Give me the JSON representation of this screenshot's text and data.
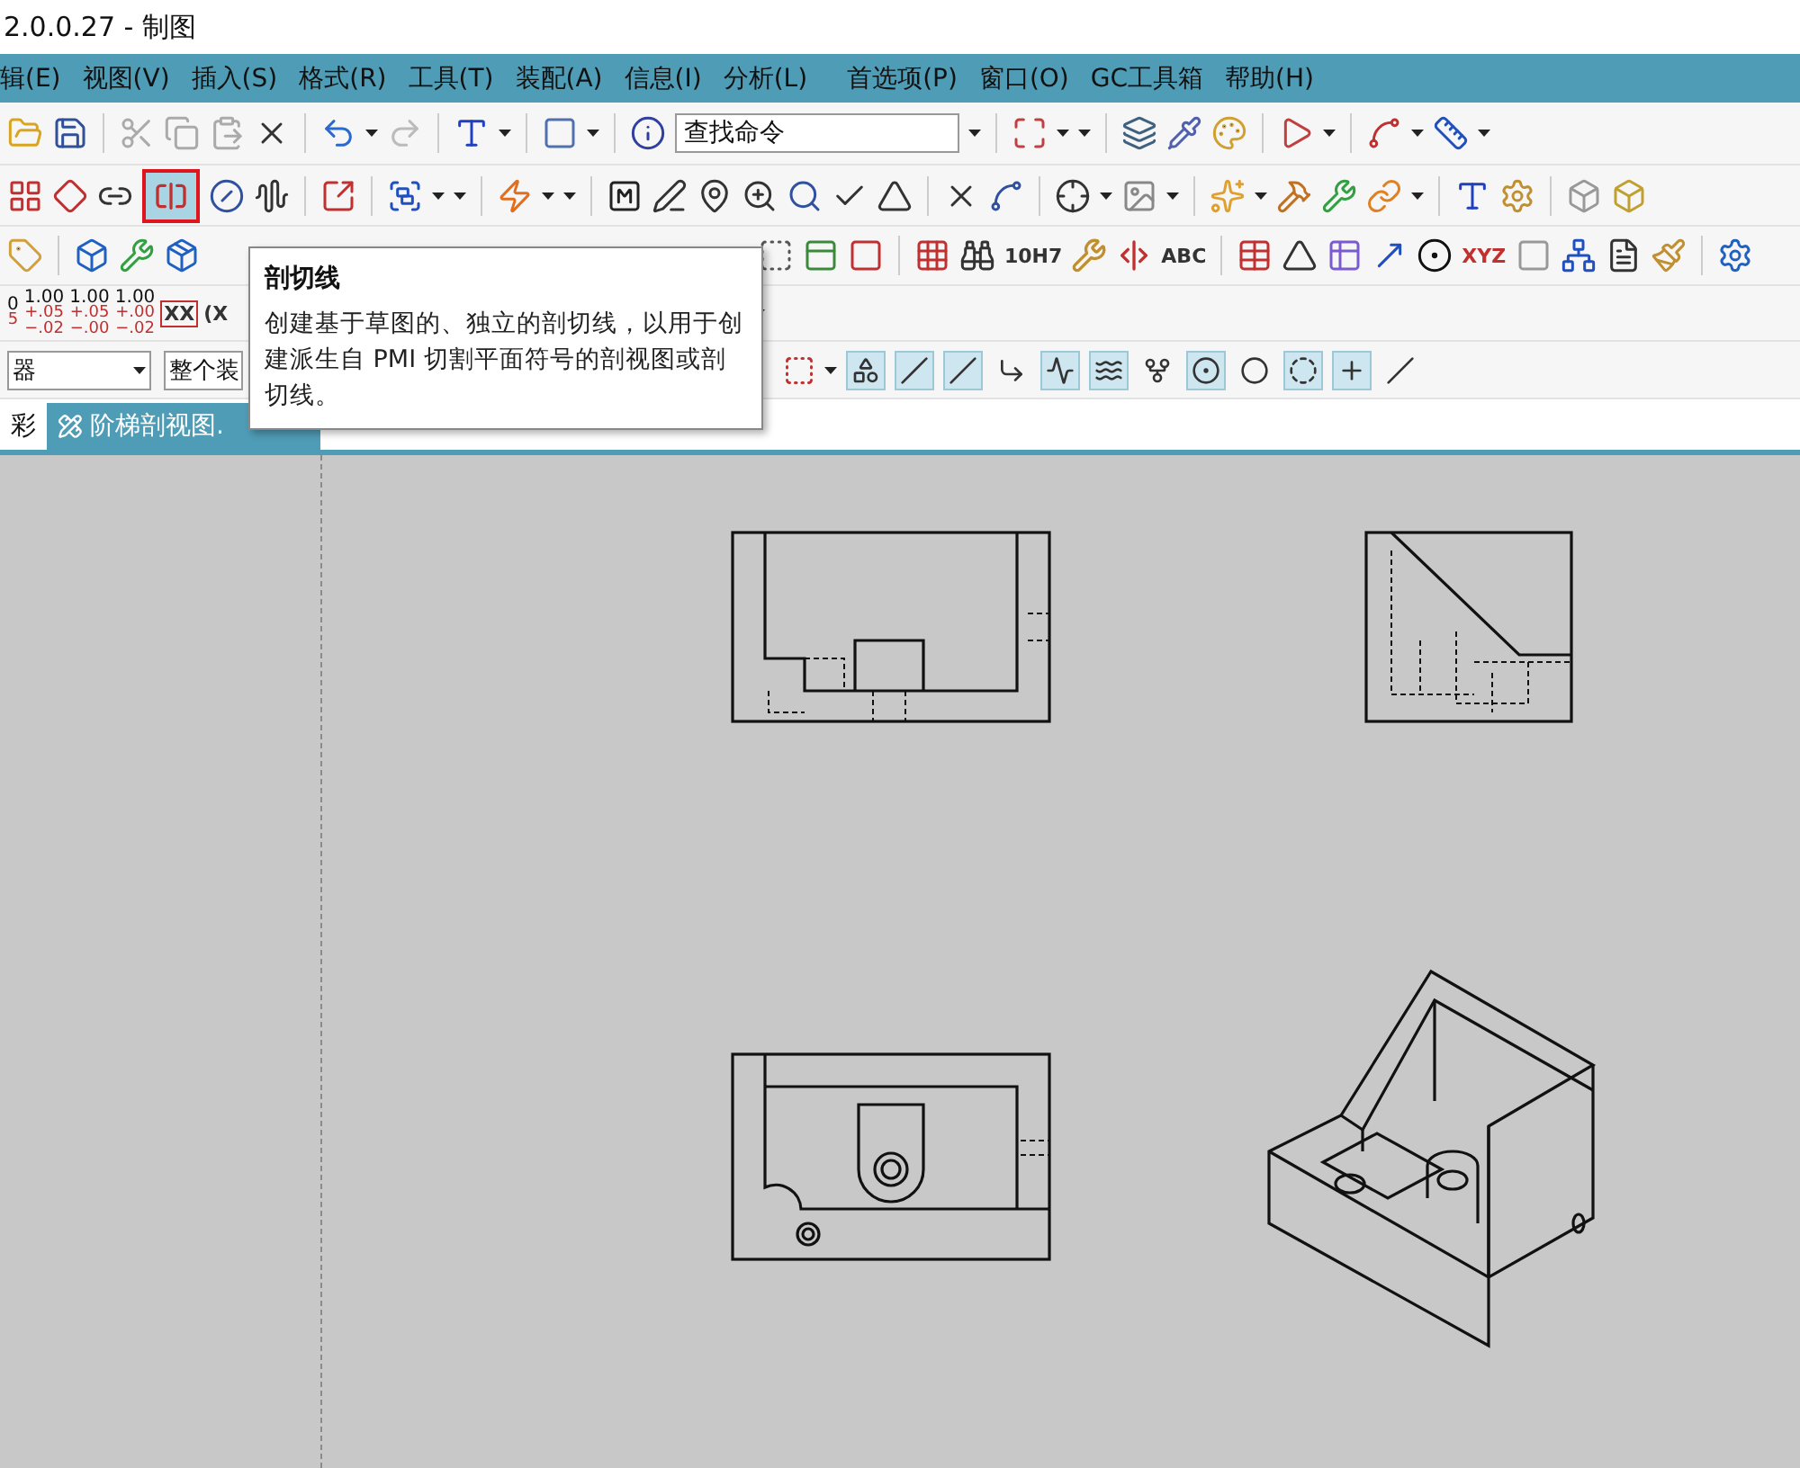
{
  "window": {
    "title": "2.0.0.27 - 制图"
  },
  "menu": [
    {
      "label": "辑(E)"
    },
    {
      "label": "视图(V)"
    },
    {
      "label": "插入(S)"
    },
    {
      "label": "格式(R)"
    },
    {
      "label": "工具(T)"
    },
    {
      "label": "装配(A)"
    },
    {
      "label": "信息(I)"
    },
    {
      "label": "分析(L)"
    },
    {
      "label": "首选项(P)"
    },
    {
      "label": "窗口(O)"
    },
    {
      "label": "GC工具箱"
    },
    {
      "label": "帮助(H)"
    }
  ],
  "search": {
    "placeholder": "查找命令"
  },
  "section_line_tool": {
    "hovered": true
  },
  "annotation_tools": [
    {
      "text": "10H7"
    },
    {
      "text": "ABC"
    },
    {
      "text": "XYZ"
    }
  ],
  "tolerance_styles": [
    {
      "value": "0",
      "upper": "5"
    },
    {
      "value": "1.00",
      "upper": "+.05",
      "lower": "−.02"
    },
    {
      "value": "1.00",
      "upper": "+.05",
      "lower": "−.00"
    },
    {
      "value": "1.00",
      "upper": "+.00",
      "lower": "−.02"
    }
  ],
  "text_styles": [
    "XX",
    "(X"
  ],
  "selection": {
    "filter": "器",
    "scope": "整个装"
  },
  "snap_points": [
    {
      "on": true
    },
    {
      "on": true
    },
    {
      "on": true
    },
    {
      "on": false
    },
    {
      "on": true
    },
    {
      "on": true
    },
    {
      "on": false
    },
    {
      "on": true
    },
    {
      "on": false
    },
    {
      "on": true
    },
    {
      "on": true
    },
    {
      "on": false
    }
  ],
  "tabs": [
    {
      "label": "彩",
      "selected": false
    },
    {
      "label": "阶梯剖视图.",
      "selected": true
    }
  ],
  "tooltip": {
    "title": "剖切线",
    "text": "创建基于草图的、独立的剖切线，以用于创建派生自 PMI 切割平面符号的剖视图或剖切线。"
  }
}
